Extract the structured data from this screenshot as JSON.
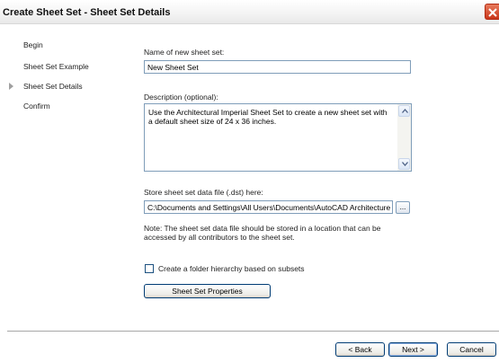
{
  "window": {
    "title": "Create Sheet Set - Sheet Set Details"
  },
  "nav": {
    "items": [
      "Begin",
      "Sheet Set Example",
      "Sheet Set Details",
      "Confirm"
    ],
    "current": "Sheet Set Details"
  },
  "form": {
    "name_label": "Name of new sheet set:",
    "name_value": "New Sheet Set",
    "description_label": "Description (optional):",
    "description_value": "Use the Architectural Imperial Sheet Set to create a new sheet set with a default sheet size of 24 x 36 inches.",
    "store_label": "Store sheet set data file (.dst) here:",
    "store_value": "C:\\Documents and Settings\\All Users\\Documents\\AutoCAD Architecture",
    "browse_label": "...",
    "note": "Note: The sheet set data file should be stored in a location that can be accessed by all contributors to the sheet set.",
    "checkbox_label": "Create a folder hierarchy based on subsets",
    "checkbox_checked": false,
    "properties_button": "Sheet Set Properties"
  },
  "footer": {
    "back_label": "< Back",
    "next_label": "Next >",
    "cancel_label": "Cancel"
  }
}
